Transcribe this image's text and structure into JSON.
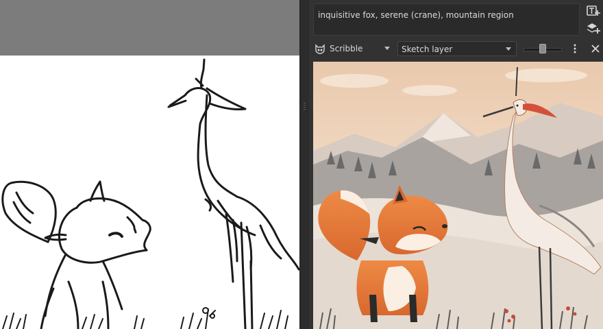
{
  "prompt": {
    "text": "inquisitive fox, serene (crane), mountain region"
  },
  "toolbar": {
    "style_label": "Scribble",
    "layer_selected": "Sketch layer",
    "strength_value": 0.5
  },
  "icons": {
    "add_text": "text-plus-icon",
    "add_layer": "layers-plus-icon",
    "style": "cat-face-icon",
    "menu": "vertical-dots-icon",
    "close": "close-icon"
  },
  "colors": {
    "panel_bg": "#323232",
    "input_bg": "#2a2a2a",
    "canvas_bg": "#ffffff",
    "fox_orange": "#e0783a",
    "crane_red": "#d4503a",
    "sky_peach": "#f3dcc6"
  }
}
